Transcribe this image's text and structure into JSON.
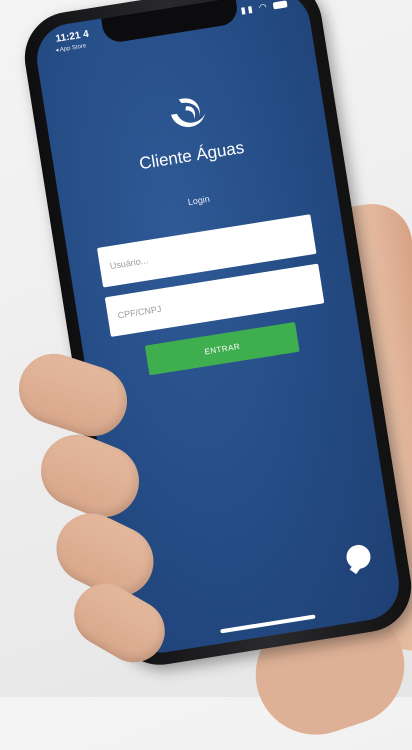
{
  "status_bar": {
    "time": "11:21 4",
    "back_label": "◂ App Store"
  },
  "app": {
    "name": "Cliente Águas",
    "login_label": "Login"
  },
  "form": {
    "user_placeholder": "Usuário...",
    "cpf_placeholder": "CPF/CNPJ",
    "submit_label": "ENTRAR"
  },
  "colors": {
    "screen_bg": "#244b84",
    "button_green": "#3fae4f"
  },
  "icons": {
    "chat": "chat-bubble-icon",
    "logo": "water-swirl-logo"
  }
}
